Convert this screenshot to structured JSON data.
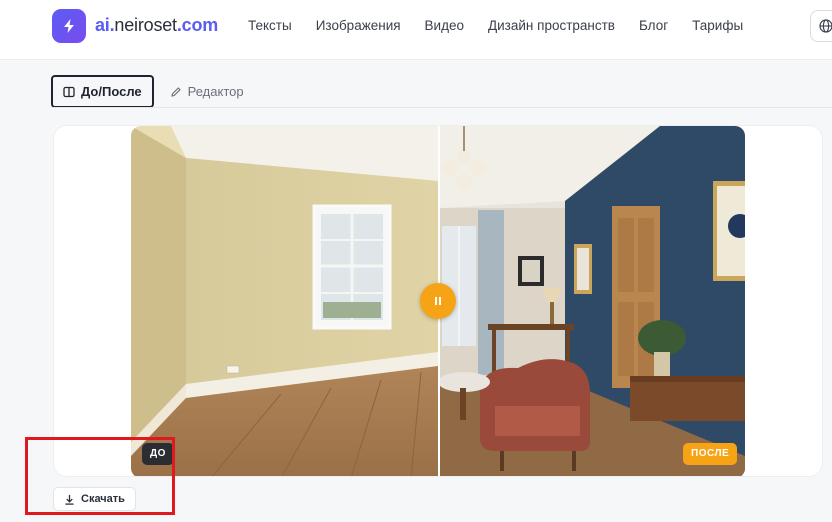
{
  "header": {
    "logo_text_prefix": "ai.",
    "logo_text_brand": "neiroset",
    "logo_text_suffix": ".com",
    "logo_icon": "bolt-icon",
    "nav": [
      "Тексты",
      "Изображения",
      "Видео",
      "Дизайн пространств",
      "Блог",
      "Тарифы"
    ],
    "globe_icon": "globe-icon"
  },
  "tabs": [
    {
      "label": "До/После",
      "icon": "split-view-icon",
      "active": true
    },
    {
      "label": "Редактор",
      "icon": "pencil-icon",
      "active": false
    }
  ],
  "comparison": {
    "before_label": "ДО",
    "after_label": "ПОСЛЕ",
    "handle_icon": "pause-icon"
  },
  "actions": {
    "download_label": "Скачать",
    "download_icon": "download-icon"
  },
  "colors": {
    "accent": "#5a5cf2",
    "handle": "#f6a416",
    "annotation": "#e0191e"
  }
}
